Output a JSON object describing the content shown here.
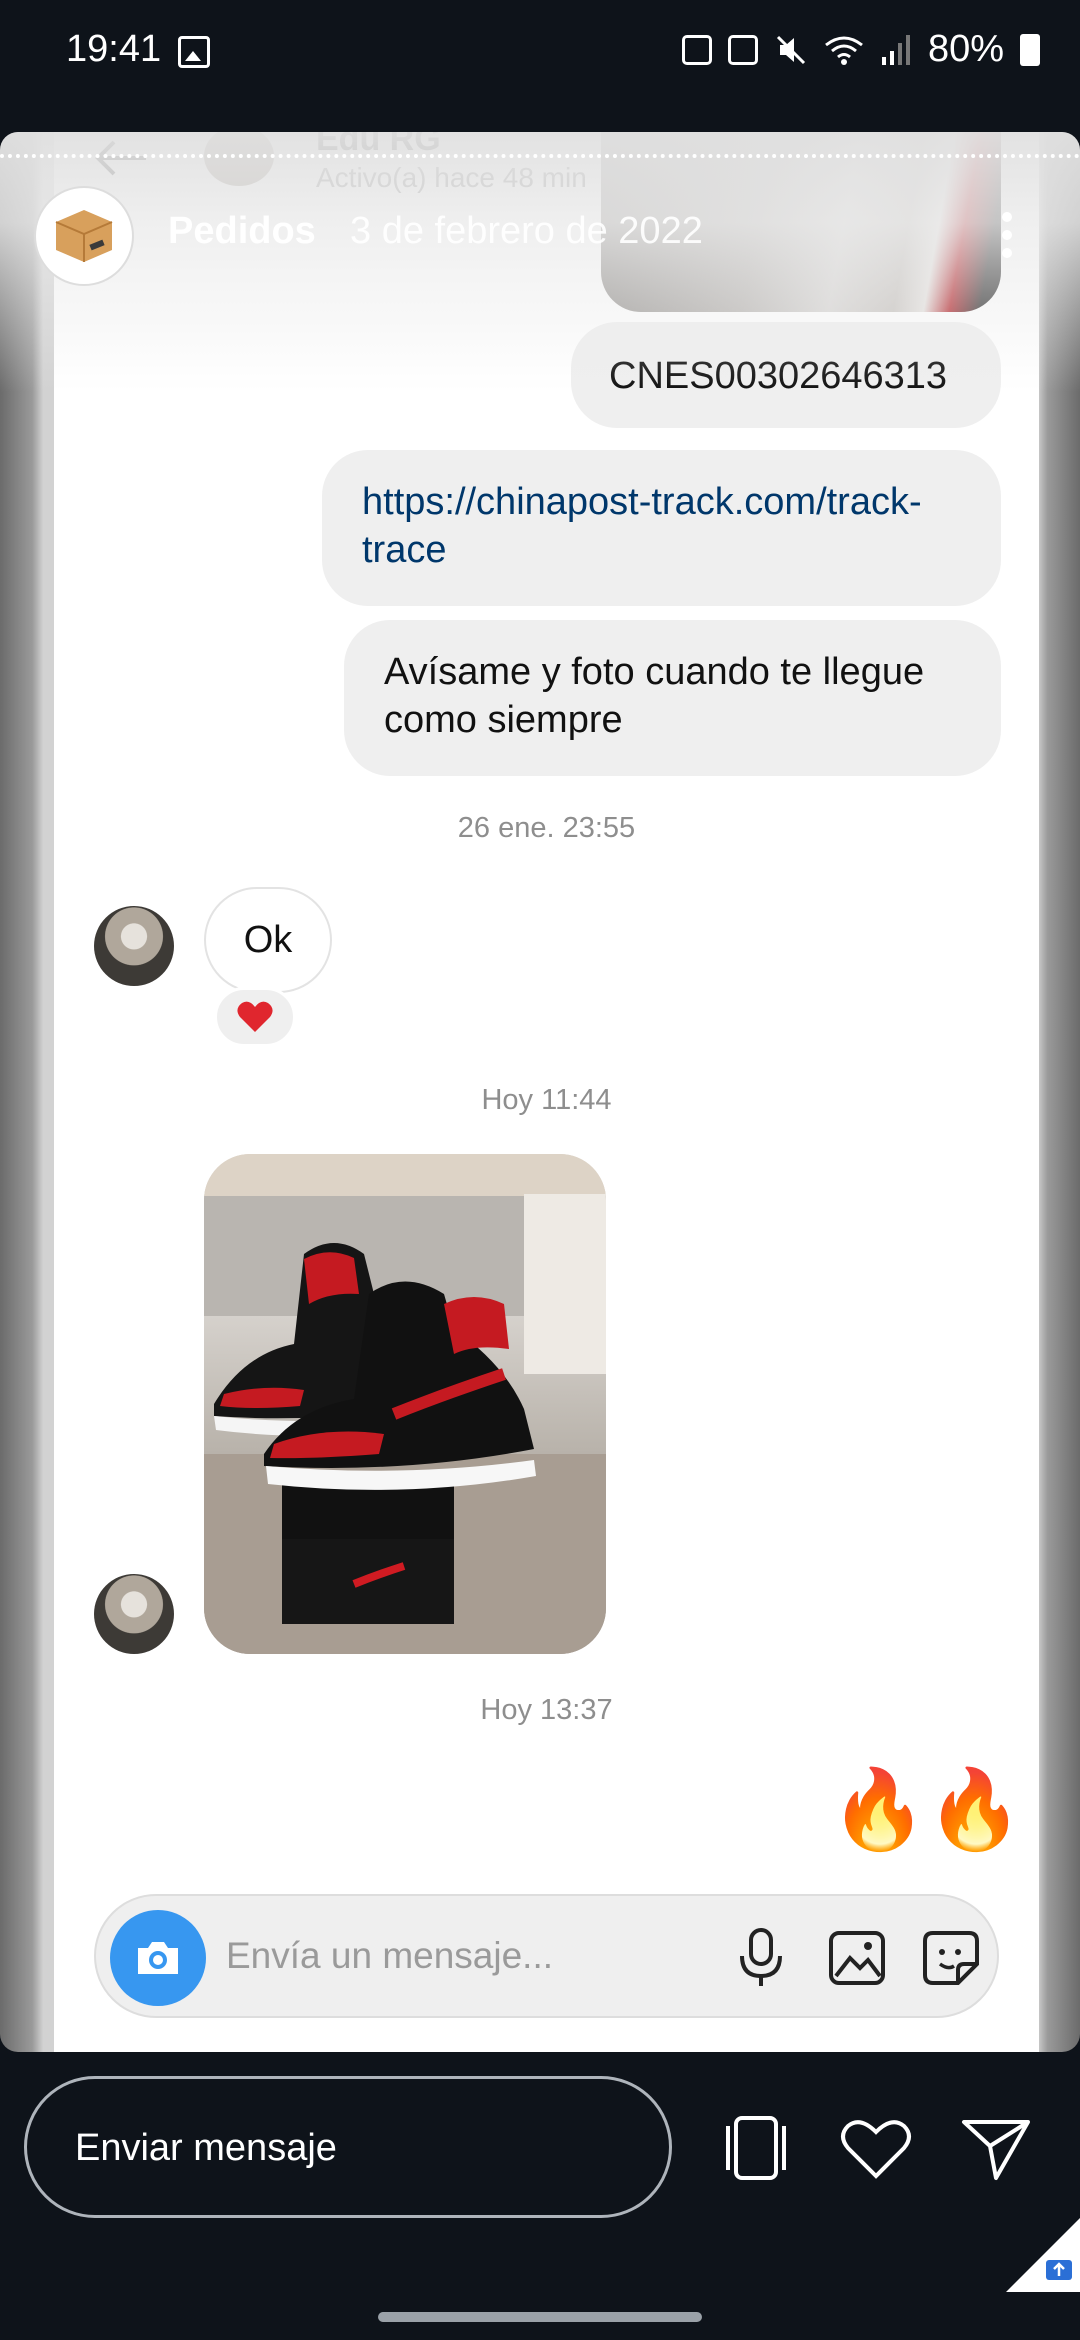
{
  "status_bar": {
    "time": "19:41",
    "battery": "80%",
    "icons": [
      "image-icon",
      "upload-icon",
      "nfc-icon",
      "mute-icon",
      "wifi-icon",
      "signal-icon",
      "battery-icon"
    ]
  },
  "chat": {
    "contact_name": "Edu RG",
    "contact_status": "Activo(a) hace 48 min",
    "icons": [
      "back-arrow-icon",
      "phone-icon",
      "video-call-icon"
    ]
  },
  "story": {
    "account_name": "Pedidos",
    "date": "3 de febrero de 2022",
    "avatar_icon": "package-box-icon",
    "more_icon": "more-vertical-icon"
  },
  "messages": {
    "tracking_code": "CNES00302646313",
    "tracking_link": "https://chinapost-track.com/track-trace",
    "notice": "Avísame y foto cuando te llegue como siempre",
    "timestamp_1": "26 ene. 23:55",
    "reply_ok": "Ok",
    "reaction": "❤️",
    "timestamp_2": "Hoy 11:44",
    "timestamp_3": "Hoy 13:37",
    "emoji_reply": "🔥"
  },
  "composer": {
    "placeholder": "Envía un mensaje...",
    "icons": [
      "camera-icon",
      "microphone-icon",
      "gallery-icon",
      "sticker-icon"
    ]
  },
  "bottom_bar": {
    "send_label": "Enviar mensaje",
    "icons": [
      "more-media-icon",
      "heart-icon",
      "share-icon"
    ]
  },
  "colors": {
    "background": "#0e131a",
    "bubble": "#efefef",
    "link": "#00376b",
    "camera_button": "#3797f0",
    "heart": "#e0262e"
  }
}
